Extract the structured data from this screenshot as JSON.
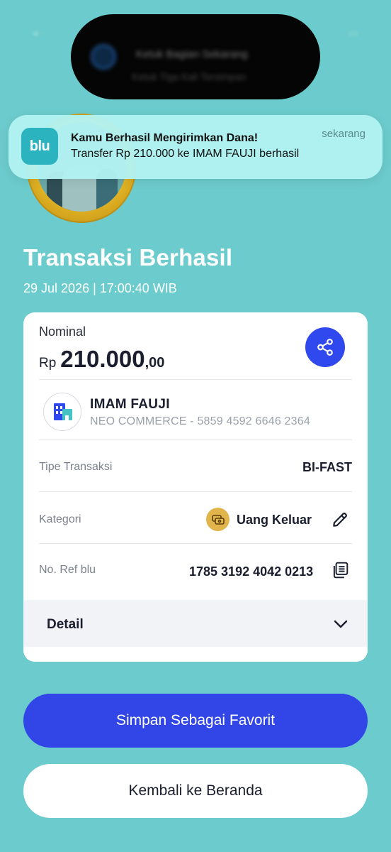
{
  "notification": {
    "app_logo_text": "blu",
    "title": "Kamu Berhasil Mengirimkan Dana!",
    "body": "Transfer Rp 210.000 ke IMAM FAUJI berhasil",
    "time": "sekarang"
  },
  "island": {
    "line1": "Ketuk Bagian Sekarang",
    "line2": "Ketuk Tiga Kali Tersimpan"
  },
  "header": {
    "title": "Transaksi Berhasil",
    "datetime": "29 Jul 2026 | 17:00:40 WIB"
  },
  "card": {
    "nominal_label": "Nominal",
    "currency": "Rp",
    "amount_main": "210.000",
    "amount_decimal": ",00",
    "recipient_name": "IMAM FAUJI",
    "recipient_detail": "NEO COMMERCE - 5859 4592 6646 2364",
    "rows": {
      "type_label": "Tipe Transaksi",
      "type_value": "BI-FAST",
      "category_label": "Kategori",
      "category_value": "Uang Keluar",
      "ref_label": "No. Ref blu",
      "ref_value": "1785 3192 4042 0213"
    },
    "detail_label": "Detail"
  },
  "buttons": {
    "favorite": "Simpan Sebagai Favorit",
    "home": "Kembali ke Beranda"
  },
  "colors": {
    "background": "#6ccbcc",
    "primary": "#3246e8",
    "category_icon": "#e2b54c"
  },
  "icons": {
    "share": "share-icon",
    "edit": "pencil-icon",
    "copy": "copy-icon",
    "chevron": "chevron-down-icon",
    "bank": "bank-logo-icon",
    "category": "money-out-icon"
  }
}
